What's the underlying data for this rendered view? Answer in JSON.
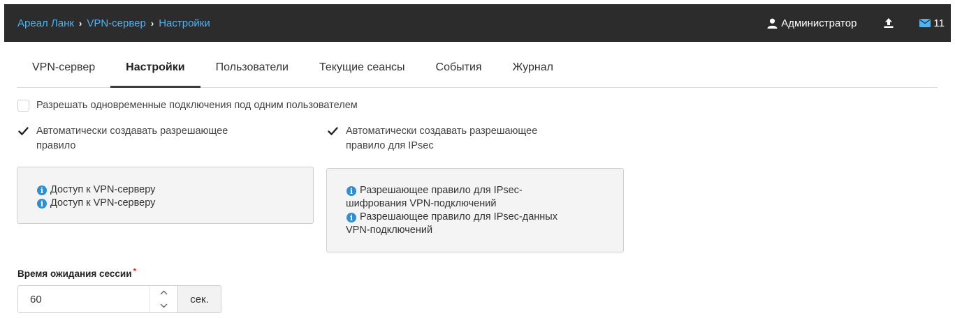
{
  "header": {
    "breadcrumb": [
      "Ареал Ланк",
      "VPN-сервер",
      "Настройки"
    ],
    "breadcrumb_separator": "›",
    "user_name": "Администратор",
    "mail_count": "11",
    "accent_color": "#4fb3f0"
  },
  "tabs": [
    {
      "label": "VPN-сервер",
      "active": false
    },
    {
      "label": "Настройки",
      "active": true
    },
    {
      "label": "Пользователи",
      "active": false
    },
    {
      "label": "Текущие сеансы",
      "active": false
    },
    {
      "label": "События",
      "active": false
    },
    {
      "label": "Журнал",
      "active": false
    }
  ],
  "settings": {
    "simultaneous": {
      "label": "Разрешать одновременные подключения под одним пользователем",
      "checked": false
    },
    "auto_rule": {
      "label_line1": "Автоматически создавать разрешающее",
      "label_line2": "правило",
      "checked": true
    },
    "auto_rule_ipsec": {
      "label_line1": "Автоматически создавать разрешающее",
      "label_line2": "правило для IPsec",
      "checked": true
    },
    "rules_box": [
      "Доступ к VPN-серверу",
      "Доступ к VPN-серверу"
    ],
    "ipsec_box": [
      {
        "line1": "Разрешающее правило для IPsec-",
        "line2": "шифрования VPN-подключений"
      },
      {
        "line1": "Разрешающее правило для IPsec-данных",
        "line2": "VPN-подключений"
      }
    ],
    "info_icon": "info-circle-icon",
    "info_icon_color": "#2d8fd6"
  },
  "timeout": {
    "label": "Время ожидания сессии",
    "required_mark": "*",
    "value": "60",
    "unit": "сек."
  }
}
